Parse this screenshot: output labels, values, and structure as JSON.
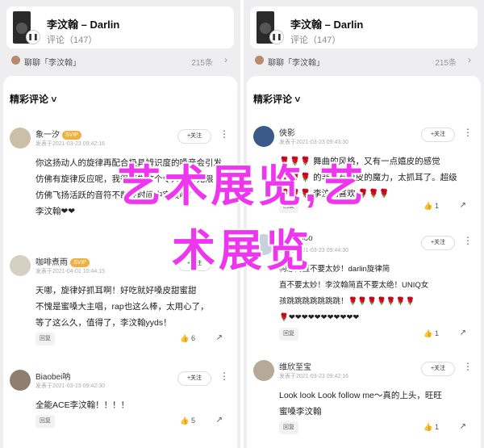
{
  "player": {
    "title": "李汶翰 – Darlin",
    "subtitle": "评论（147）",
    "pause_icon": "pause-icon"
  },
  "listening": {
    "text": "聊聊「李汶翰」",
    "count": "215条",
    "arrow": "›"
  },
  "sheet": {
    "title": "精彩评论 ˅"
  },
  "follow_label": "+关注",
  "reply_label": "回复",
  "svip_label": "SVIP",
  "left_comments": [
    {
      "name": "象一汐",
      "svip": true,
      "time": "发表于2021-03-23 09:42:16",
      "lines": [
        "你这扬动人的旋律再配合极具辨识度的嗓音会引发",
        "仿佛有旋律反应呢，我很感觉这个令人惊喜无限，",
        "仿佛飞扬活跃的音符不断在时间中穿梭啊！",
        "李汶翰❤❤"
      ],
      "reply": "回复",
      "likes": ""
    },
    {
      "name": "咖啡煮雨",
      "svip": true,
      "time": "发表于2021-04-01 10:44:15",
      "lines": [
        "天哪，旋律好抓耳啊！好吃就好嗓皮甜蜜甜",
        "不愧是蜜嗓大主唱，rap也这么棒，太用心了，",
        "等了这么久，值得了，李汶翰yyds！"
      ],
      "reply": "回复",
      "likes": "6"
    },
    {
      "name": "Biaobei呐",
      "svip": false,
      "time": "发表于2021-03-23 09:42:30",
      "lines": [
        "全能ACE李汶翰！！！！"
      ],
      "reply": "回复",
      "likes": "5"
    }
  ],
  "right_comments": [
    {
      "name": "俠影",
      "svip": false,
      "time": "发表于2021-03-23 09:43:30",
      "lines": [
        "🌹🌹🌹 舞曲的风格，又有一点嬉皮的感觉",
        "🌹🌹🌹 的非常有嗓皮的魔力，太抓耳了。超级",
        "🌹🌹🌹 李汶翰喜欢 🌹🌹🌹"
      ],
      "reply": "回复",
      "likes": "1"
    },
    {
      "name": "Piaceboo",
      "svip": false,
      "time": "发表于2021-03-23 09:44:30",
      "lines": [
        "构思简直不要太妙！darlin旋律简",
        "直不要太妙！李汶翰简直不要太绝！UNIQ女",
        "孩跳跳跳跳跳跳跳！🌹🌹🌹🌹🌹🌹🌹",
        "🌹❤❤❤❤❤❤❤❤❤❤❤"
      ],
      "reply": "回复",
      "likes": "1"
    },
    {
      "name": "维欣至宝",
      "svip": false,
      "time": "发表于2021-03-23 09:42:16",
      "lines": [
        "Look look Look follow me～真的上头，旺旺",
        "蜜嗓李汶翰"
      ],
      "reply": "回复",
      "likes": "1"
    }
  ],
  "overlay": {
    "line1": "艺术展览,艺",
    "line2": "术展览"
  }
}
